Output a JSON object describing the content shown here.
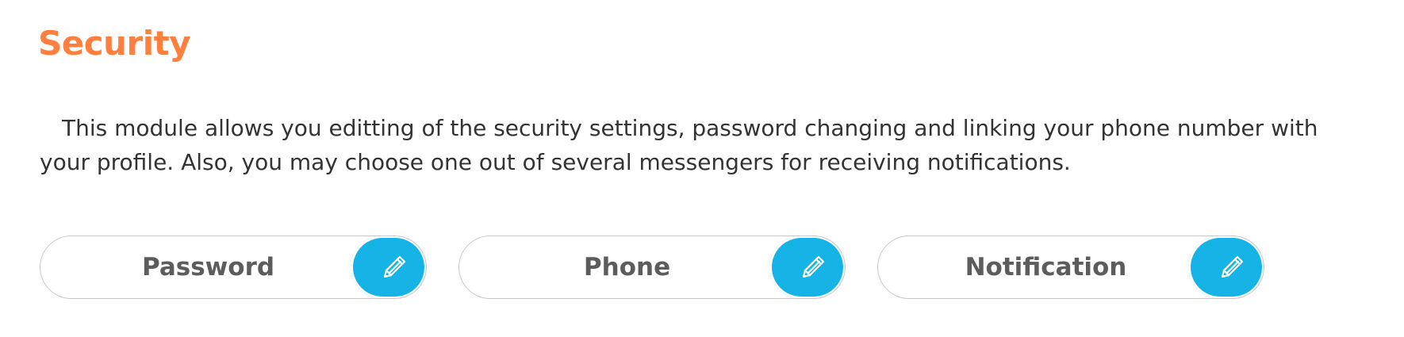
{
  "page": {
    "title": "Security",
    "description": "This module allows you editting of the security settings, password changing and linking your phone number with your profile. Also, you may choose one out of several messengers for receiving notifications."
  },
  "buttons": [
    {
      "label": "Password",
      "icon": "pencil-icon"
    },
    {
      "label": "Phone",
      "icon": "pencil-icon"
    },
    {
      "label": "Notification",
      "icon": "pencil-icon"
    }
  ],
  "colors": {
    "title": "#ff7f3f",
    "accent": "#16b3e6",
    "button_text": "#5c5c5c",
    "body_text": "#333333"
  }
}
